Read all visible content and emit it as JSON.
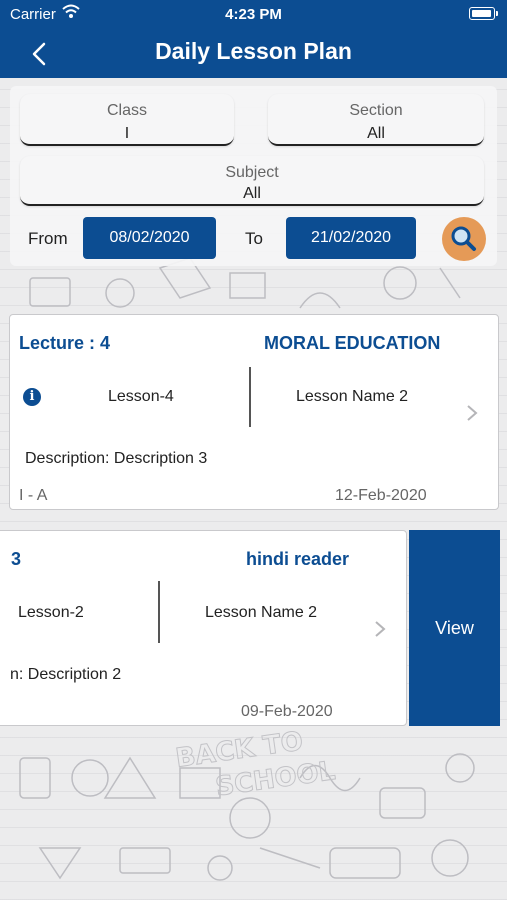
{
  "status_bar": {
    "carrier": "Carrier",
    "time": "4:23 PM"
  },
  "nav": {
    "title": "Daily Lesson Plan",
    "back_icon": "chevron-left-icon"
  },
  "filters": {
    "class": {
      "label": "Class",
      "value": "I"
    },
    "section": {
      "label": "Section",
      "value": "All"
    },
    "subject": {
      "label": "Subject",
      "value": "All"
    },
    "from_label": "From",
    "from_date": "08/02/2020",
    "to_label": "To",
    "to_date": "21/02/2020",
    "search_icon": "search-icon",
    "search_color": "#e59a57"
  },
  "lessons": [
    {
      "lecture": "Lecture : 4",
      "subject": "MORAL EDUCATION",
      "lesson": "Lesson-4",
      "lesson_name": "Lesson Name 2",
      "description": "Description: Description 3",
      "class_section": "I - A",
      "date": "12-Feb-2020"
    },
    {
      "lecture": "3",
      "subject": "hindi reader",
      "lesson": "Lesson-2",
      "lesson_name": "Lesson Name 2",
      "description": "n: Description 2",
      "date": "09-Feb-2020",
      "swipe_action": "View"
    }
  ],
  "colors": {
    "primary": "#0c4d92",
    "accent": "#e59a57"
  }
}
